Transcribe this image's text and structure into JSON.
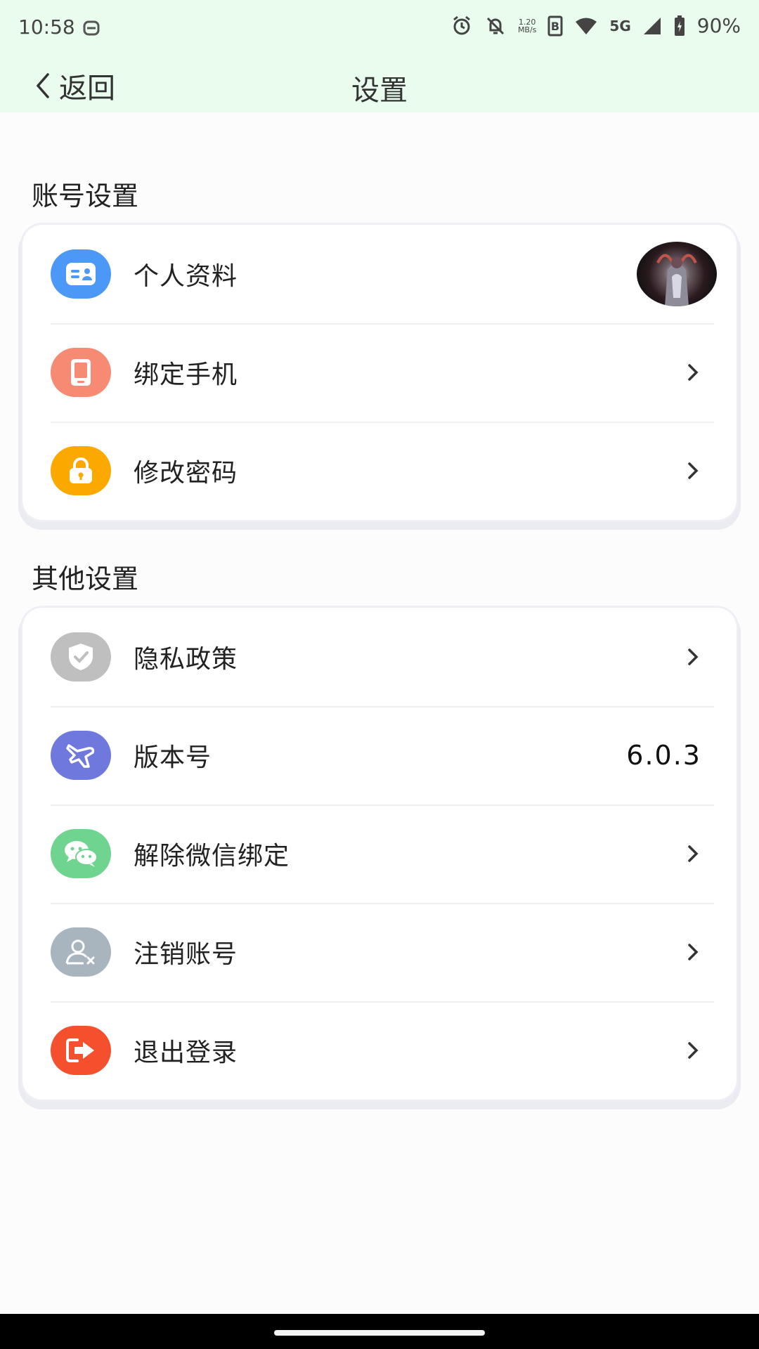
{
  "status_bar": {
    "time": "10:58",
    "net_speed_top": "1.20",
    "net_speed_bottom": "MB/s",
    "network": "5G",
    "battery": "90%"
  },
  "nav": {
    "back_label": "返回",
    "title": "设置"
  },
  "sections": {
    "account": {
      "title": "账号设置",
      "items": [
        {
          "label": "个人资料",
          "icon": "profile-card-icon",
          "color": "#4b98f7"
        },
        {
          "label": "绑定手机",
          "icon": "phone-icon",
          "color": "#f78a73"
        },
        {
          "label": "修改密码",
          "icon": "lock-icon",
          "color": "#fba800"
        }
      ]
    },
    "other": {
      "title": "其他设置",
      "items": [
        {
          "label": "隐私政策",
          "icon": "shield-check-icon",
          "color": "#bfbfbf"
        },
        {
          "label": "版本号",
          "icon": "plane-icon",
          "color": "#6e78dd",
          "value": "6.0.3"
        },
        {
          "label": "解除微信绑定",
          "icon": "wechat-icon",
          "color": "#6fd48f"
        },
        {
          "label": "注销账号",
          "icon": "user-remove-icon",
          "color": "#a8b5bf"
        },
        {
          "label": "退出登录",
          "icon": "logout-icon",
          "color": "#f5502e"
        }
      ]
    }
  }
}
